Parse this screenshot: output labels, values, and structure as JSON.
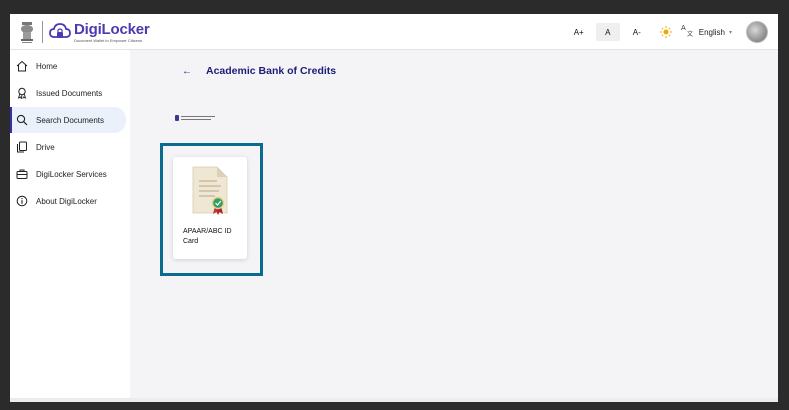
{
  "header": {
    "brand_name": "DigiLocker",
    "brand_tagline": "Document Wallet to Empower Citizens",
    "font_increase": "A+",
    "font_normal": "A",
    "font_decrease": "A-",
    "language": "English",
    "icons": [
      "emblem-icon",
      "cloud-lock-icon",
      "sun-icon",
      "translate-icon",
      "chevron-down-icon",
      "avatar"
    ]
  },
  "sidebar": {
    "items": [
      {
        "label": "Home",
        "icon": "home-icon"
      },
      {
        "label": "Issued Documents",
        "icon": "award-icon"
      },
      {
        "label": "Search Documents",
        "icon": "search-icon",
        "active": true
      },
      {
        "label": "Drive",
        "icon": "files-icon"
      },
      {
        "label": "DigiLocker Services",
        "icon": "briefcase-icon"
      },
      {
        "label": "About DigiLocker",
        "icon": "info-icon"
      }
    ]
  },
  "main": {
    "title": "Academic Bank of Credits",
    "document_card": {
      "label": "APAAR/ABC ID Card",
      "icon": "verified-document-icon"
    }
  },
  "colors": {
    "brand": "#4b3bb0",
    "title": "#1c1c7a",
    "highlight": "#0b6b8e",
    "active_nav_bg": "#eaf1fb"
  }
}
